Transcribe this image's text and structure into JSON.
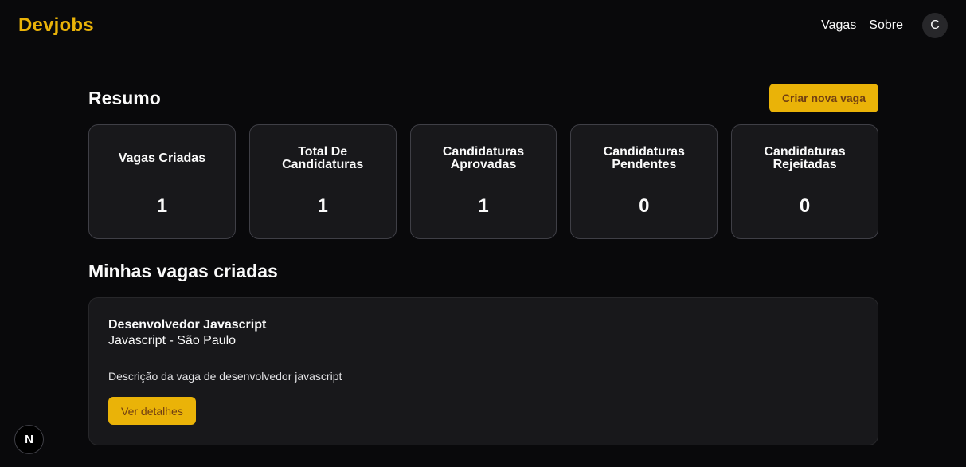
{
  "header": {
    "logo": "Devjobs",
    "nav": {
      "vagas": "Vagas",
      "sobre": "Sobre",
      "avatar_initial": "C"
    }
  },
  "summary": {
    "title": "Resumo",
    "create_button": "Criar nova vaga",
    "cards": [
      {
        "label": "Vagas Criadas",
        "value": "1"
      },
      {
        "label": "Total De Candidaturas",
        "value": "1"
      },
      {
        "label": "Candidaturas Aprovadas",
        "value": "1"
      },
      {
        "label": "Candidaturas Pendentes",
        "value": "0"
      },
      {
        "label": "Candidaturas Rejeitadas",
        "value": "0"
      }
    ]
  },
  "jobs": {
    "title": "Minhas vagas criadas",
    "items": [
      {
        "title": "Desenvolvedor Javascript",
        "meta": "Javascript - São Paulo",
        "description": "Descrição da vaga de desenvolvedor javascript",
        "details_button": "Ver detalhes"
      }
    ]
  },
  "devtools": {
    "badge": "N"
  },
  "colors": {
    "accent": "#eab308",
    "background": "#09090b",
    "card": "#18181b"
  }
}
